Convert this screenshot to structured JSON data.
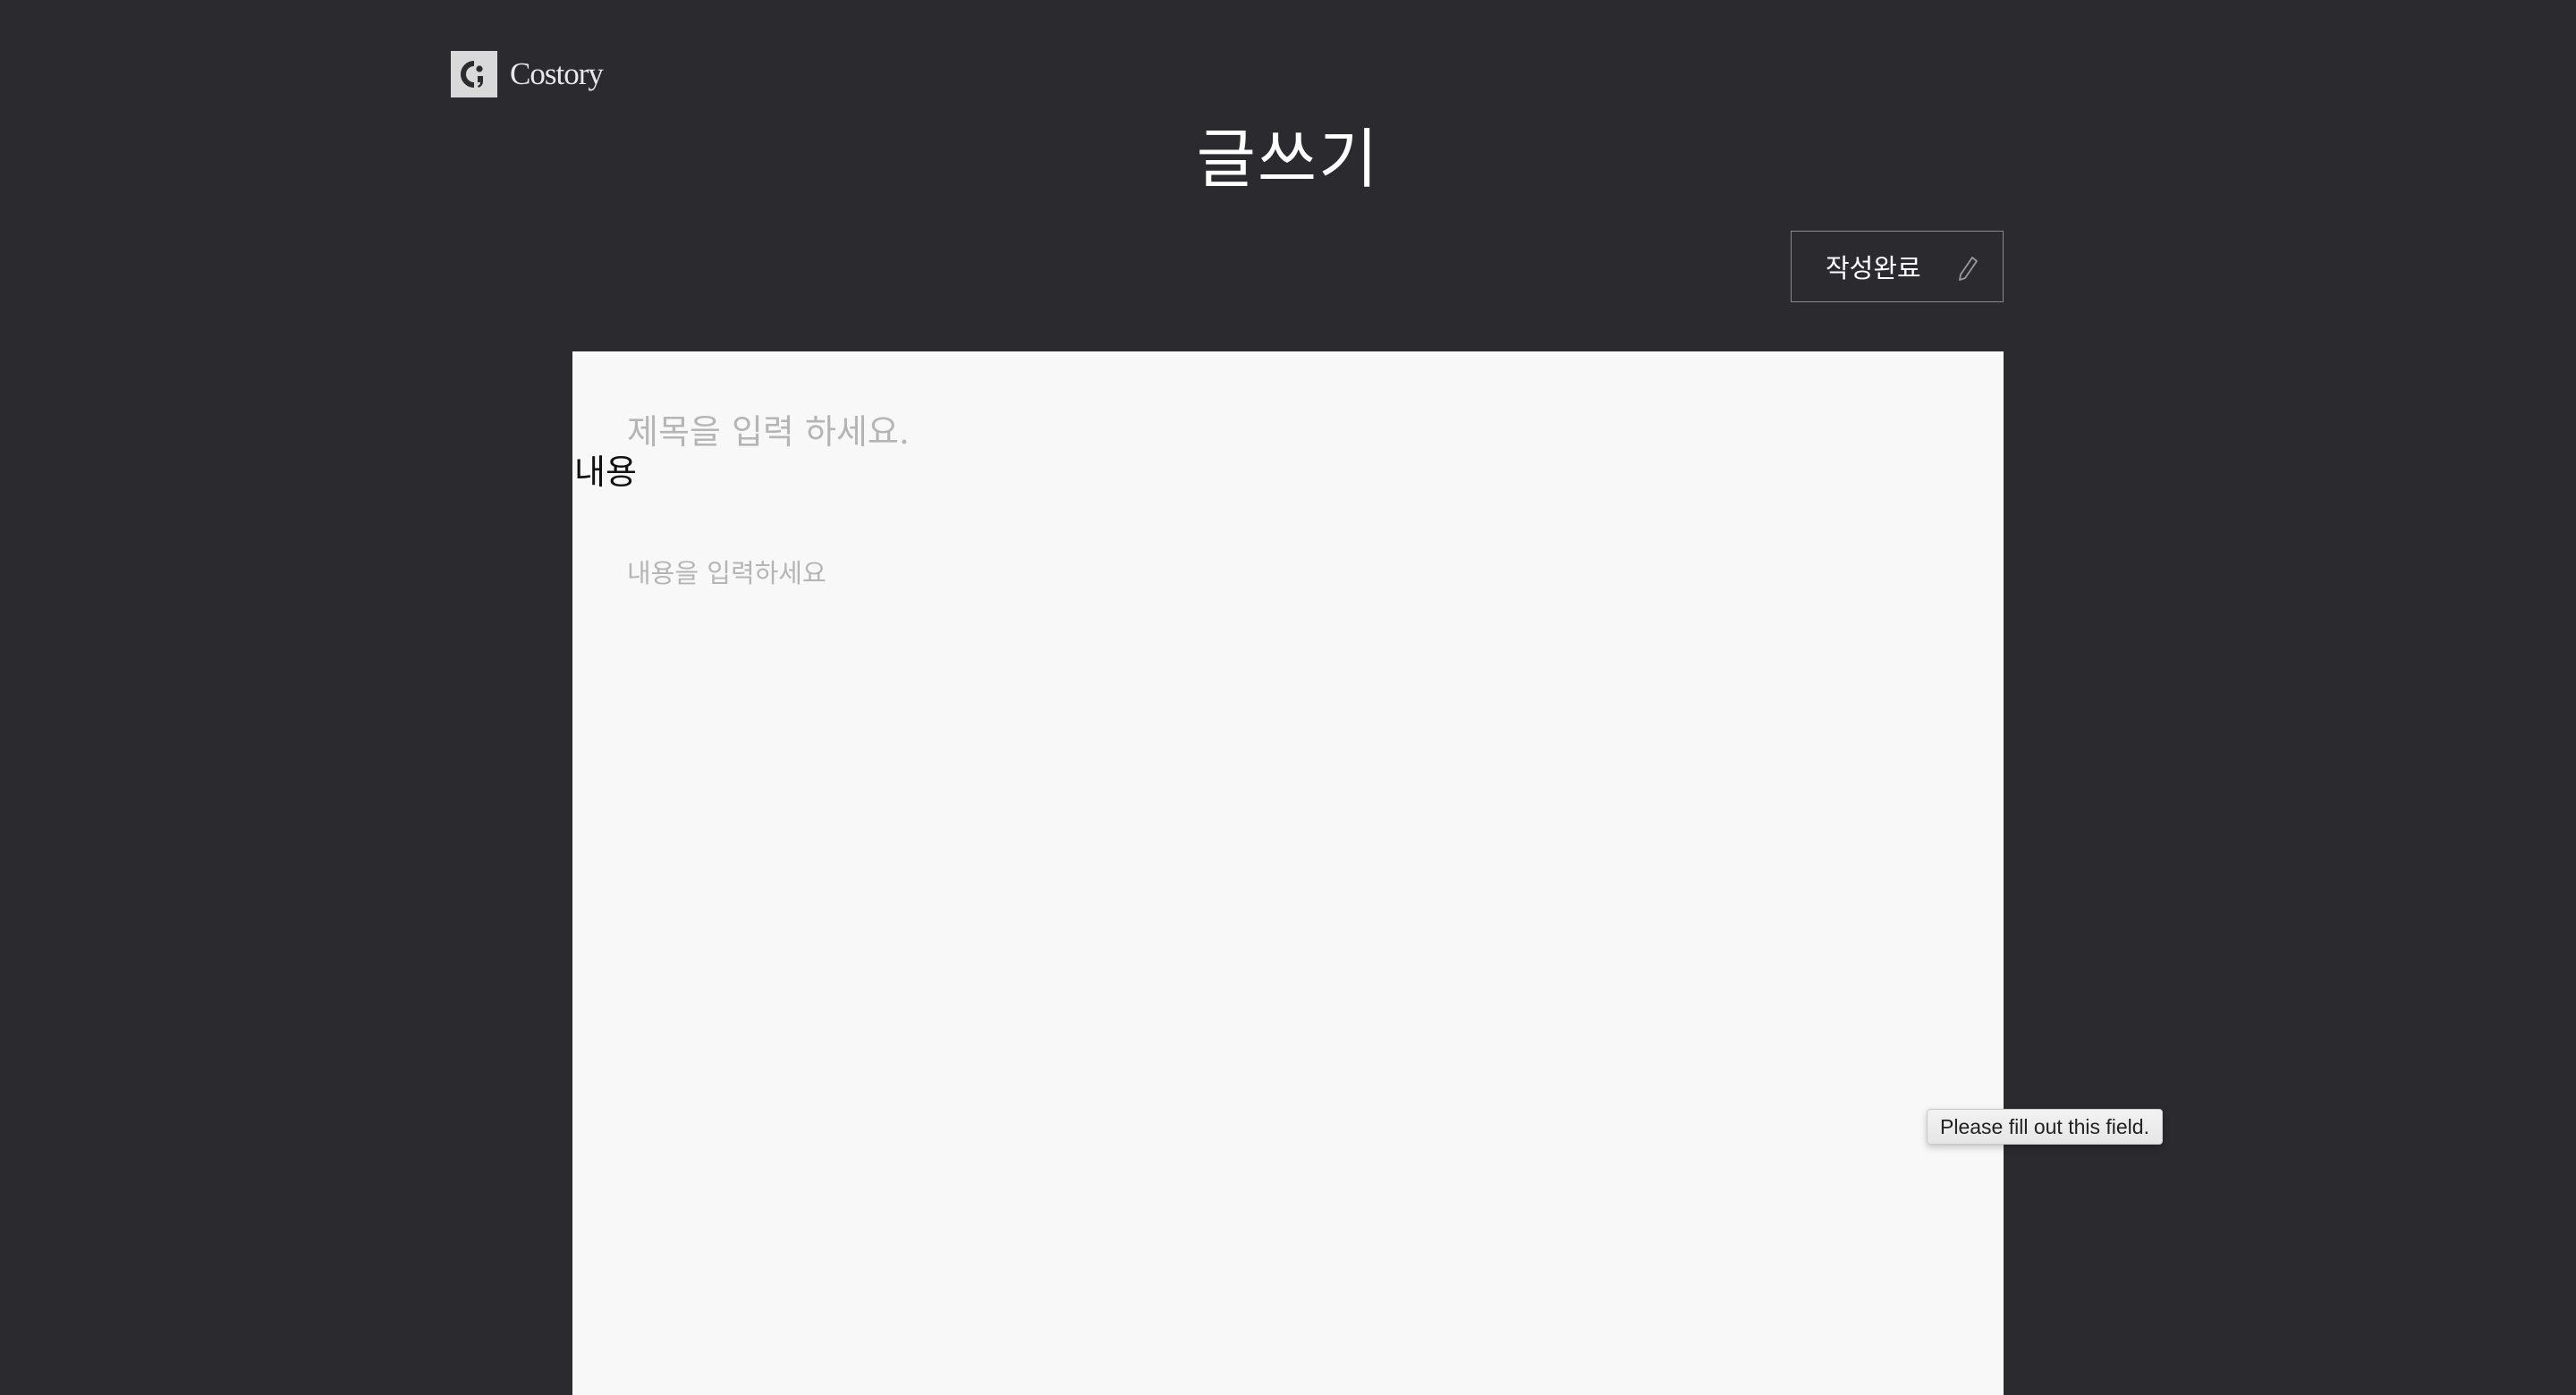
{
  "brand": {
    "name": "Costory",
    "logo_icon": "costory-logo-icon"
  },
  "header": {
    "title": "글쓰기"
  },
  "toolbar": {
    "submit_label": "작성완료",
    "submit_icon": "pencil-icon"
  },
  "editor": {
    "title_placeholder": "제목을 입력 하세요.",
    "title_value": "",
    "content_label": "내용",
    "content_placeholder": "내용을 입력하세요",
    "content_value": ""
  },
  "validation": {
    "message": "Please fill out this field."
  },
  "colors": {
    "background": "#2b2a2f",
    "panel": "#f8f8f8",
    "logo_mark": "#d9d9d9"
  }
}
